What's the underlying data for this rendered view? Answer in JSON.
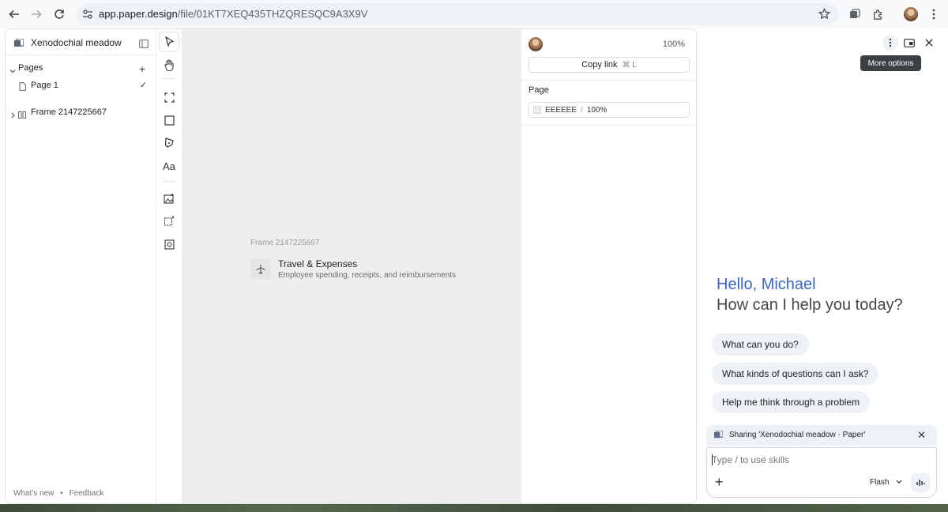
{
  "browser": {
    "url_host": "app.paper.design",
    "url_path": "/file/01KT7XEQ435THZQRESQC9A3X9V"
  },
  "layers_panel": {
    "file_title": "Xenodochial meadow",
    "pages_label": "Pages",
    "pages": [
      {
        "label": "Page 1",
        "selected": true
      }
    ],
    "frame_item": "Frame 2147225667",
    "footer_whats_new": "What's new",
    "footer_sep": "•",
    "footer_feedback": "Feedback"
  },
  "toolbar": {
    "text_tool": "Aa"
  },
  "canvas": {
    "frame_label": "Frame 2147225667",
    "frame_title": "Travel & Expenses",
    "frame_subtitle": "Employee spending, receipts, and reimbursements",
    "background": "#EEEEEE"
  },
  "properties": {
    "zoom": "100%",
    "copy_link": "Copy link",
    "copy_shortcut": "⌘ L",
    "page_label": "Page",
    "page_color": "EEEEEE",
    "page_opacity": "100%"
  },
  "assistant": {
    "tooltip": "More options",
    "greeting": "Hello, Michael",
    "prompt": "How can I help you today?",
    "suggestions": [
      "What can you do?",
      "What kinds of questions can I ask?",
      "Help me think through a problem"
    ],
    "sharing_text": "Sharing 'Xenodochial meadow · Paper'",
    "input_placeholder": "Type / to use skills",
    "model": "Flash",
    "accent_color": "#3c66c9"
  }
}
